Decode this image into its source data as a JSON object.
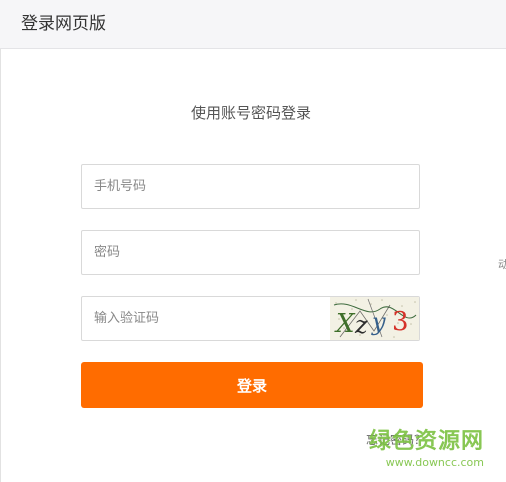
{
  "header": {
    "title": "登录网页版"
  },
  "login": {
    "subtitle": "使用账号密码登录",
    "phone_placeholder": "手机号码",
    "password_placeholder": "密码",
    "captcha_placeholder": "输入验证码",
    "captcha_text": "Xz?3",
    "login_label": "登录",
    "forgot_label": "忘记密码？"
  },
  "edge": {
    "text": "动"
  },
  "watermark": {
    "name": "绿色资源网",
    "url": "www.downcc.com"
  },
  "colors": {
    "accent": "#ff6c00",
    "watermark": "#7cc242"
  }
}
